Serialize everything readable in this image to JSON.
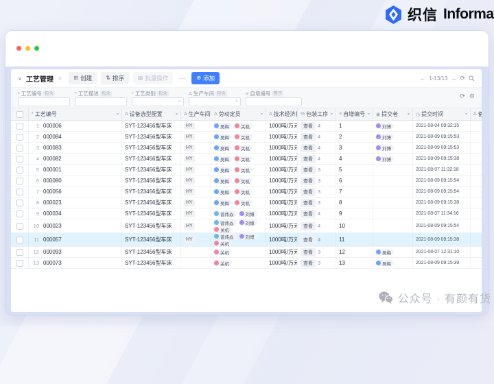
{
  "brand": {
    "name_cn": "织信",
    "name_en": "Informat",
    "accent": "#2e6bf6"
  },
  "window_controls": {
    "close": "#ff5f57",
    "minimize": "#febc2e",
    "zoom": "#28c840"
  },
  "toolbar": {
    "caret": "∨",
    "view_name": "工艺管理",
    "collapse_icon": "«",
    "buttons": [
      {
        "id": "create",
        "glyph": "⊞",
        "label": "创建",
        "enabled": true,
        "primary": false
      },
      {
        "id": "sort",
        "glyph": "⇅",
        "label": "排序",
        "enabled": true,
        "primary": false
      },
      {
        "id": "batch",
        "glyph": "▦",
        "label": "批量操作",
        "enabled": false,
        "primary": false
      },
      {
        "id": "divider",
        "type": "divider",
        "glyph": "—"
      },
      {
        "id": "add",
        "glyph": "⊕",
        "label": "添加",
        "enabled": true,
        "primary": true
      }
    ],
    "pagination": {
      "prev": "←",
      "range": "1-13/13",
      "next": "→",
      "refresh": "⟳"
    }
  },
  "filters": {
    "items": [
      {
        "id": "code",
        "icon": "*",
        "label": "工艺编号",
        "op": "包含",
        "control": "input",
        "value": ""
      },
      {
        "id": "desc",
        "icon": "*",
        "label": "工艺描述",
        "op": "包含",
        "control": "input",
        "value": ""
      },
      {
        "id": "category",
        "icon": "*",
        "label": "工艺类别",
        "op": "包含",
        "control": "select",
        "value": ""
      },
      {
        "id": "workshop",
        "icon": "A",
        "label": "生产车间",
        "op": "包含",
        "control": "select",
        "value": ""
      },
      {
        "id": "autono",
        "icon": "≡",
        "label": "自增编号",
        "op": "等于",
        "control": "input",
        "value": ""
      }
    ],
    "refresh_icon": "⟳",
    "settings_icon": "⚙"
  },
  "table": {
    "columns": [
      {
        "id": "code",
        "icon": "*",
        "label": "工艺编号"
      },
      {
        "id": "device",
        "icon": "A",
        "label": "设备选型配置"
      },
      {
        "id": "workshop",
        "icon": "A",
        "label": "生产车间"
      },
      {
        "id": "staff",
        "icon": "A",
        "label": "劳动定员"
      },
      {
        "id": "indicator",
        "icon": "A",
        "label": "技术经济指标"
      },
      {
        "id": "process",
        "icon": "%",
        "label": "包装工序"
      },
      {
        "id": "autono",
        "icon": "≡",
        "label": "自增编号"
      },
      {
        "id": "submitter",
        "icon": "◉",
        "label": "提交者"
      },
      {
        "id": "time",
        "icon": "◷",
        "label": "提交时间"
      },
      {
        "id": "note",
        "icon": "A",
        "label": "备注"
      }
    ],
    "view_button_label": "查看",
    "people_colors": {
      "吴梅": "#6fa4f8",
      "关机": "#f2849c",
      "曾炜焱": "#66b9e8",
      "刘博": "#a78bf0"
    },
    "rows": [
      {
        "index": 1,
        "code": "000006",
        "device": "SYT-123456型车床",
        "workshop": "HY",
        "staff": [
          "吴梅",
          "关机"
        ],
        "indicator": "1000吨/万元",
        "view_count": 4,
        "auto_no": 1,
        "submitter": "刘博",
        "time": "2021-08-04 09:32:15",
        "highlighted": false,
        "tall": false
      },
      {
        "index": 2,
        "code": "000084",
        "device": "SYT-123456型车床",
        "workshop": "HY",
        "staff": [
          "吴梅",
          "关机"
        ],
        "indicator": "1000吨/万元",
        "view_count": 4,
        "auto_no": 2,
        "submitter": "刘博",
        "time": "2021-08-09 09:15:53",
        "highlighted": false,
        "tall": false
      },
      {
        "index": 3,
        "code": "000083",
        "device": "SYT-123456型车床",
        "workshop": "HY",
        "staff": [
          "吴梅",
          "关机"
        ],
        "indicator": "1000吨/万元",
        "view_count": 4,
        "auto_no": 3,
        "submitter": "刘博",
        "time": "2021-08-09 09:15:53",
        "highlighted": false,
        "tall": false
      },
      {
        "index": 4,
        "code": "000082",
        "device": "SYT-123456型车床",
        "workshop": "HY",
        "staff": [
          "吴梅",
          "关机"
        ],
        "indicator": "1000吨/万元",
        "view_count": 4,
        "auto_no": 4,
        "submitter": "刘博",
        "time": "2021-08-09 09:15:38",
        "highlighted": false,
        "tall": false
      },
      {
        "index": 5,
        "code": "000001",
        "device": "SYT-123456型车床",
        "workshop": "HY",
        "staff": [
          "吴梅",
          "关机"
        ],
        "indicator": "1000吨/万元",
        "view_count": 3,
        "auto_no": 5,
        "submitter": null,
        "time": "2021-08-07 11:32:18",
        "highlighted": false,
        "tall": false
      },
      {
        "index": 6,
        "code": "000080",
        "device": "SYT-123456型车床",
        "workshop": "HY",
        "staff": [
          "吴梅",
          "关机"
        ],
        "indicator": "1000吨/万元",
        "view_count": 3,
        "auto_no": 6,
        "submitter": null,
        "time": "2021-08-09 09:15:54",
        "highlighted": false,
        "tall": false
      },
      {
        "index": 7,
        "code": "000056",
        "device": "SYT-123456型车床",
        "workshop": "HY",
        "staff": [
          "吴梅",
          "关机"
        ],
        "indicator": "1000吨/万元",
        "view_count": 3,
        "auto_no": 7,
        "submitter": null,
        "time": "2021-08-09 09:15:54",
        "highlighted": false,
        "tall": false
      },
      {
        "index": 8,
        "code": "000023",
        "device": "SYT-123456型车床",
        "workshop": "HY",
        "staff": [
          "吴梅",
          "关机"
        ],
        "indicator": "1000吨/万元",
        "view_count": 3,
        "auto_no": 8,
        "submitter": null,
        "time": "2021-08-09 09:15:38",
        "highlighted": false,
        "tall": false
      },
      {
        "index": 9,
        "code": "000034",
        "device": "SYT-123456型车床",
        "workshop": "HY",
        "staff": [
          "曾炜焱",
          "刘博"
        ],
        "indicator": "1000吨/万元",
        "view_count": 4,
        "auto_no": 9,
        "submitter": null,
        "time": "2021-08-07 11:34:16",
        "highlighted": false,
        "tall": false
      },
      {
        "index": 10,
        "code": "000023",
        "device": "SYT-123456型车床",
        "workshop": "HY",
        "staff": [
          "曾炜焱",
          "刘博",
          "关机"
        ],
        "indicator": "1000吨/万元",
        "view_count": 4,
        "auto_no": 10,
        "submitter": null,
        "time": "2021-08-09 09:15:54",
        "highlighted": false,
        "tall": true
      },
      {
        "index": 11,
        "code": "000057",
        "device": "SYT-123456型车床",
        "workshop": "HY",
        "staff": [
          "曾炜焱",
          "刘博",
          "关机"
        ],
        "indicator": "1000吨/万元",
        "view_count": 4,
        "auto_no": 11,
        "submitter": null,
        "time": "2021-08-09 09:15:38",
        "highlighted": true,
        "tall": true
      },
      {
        "index": 12,
        "code": "000093",
        "device": "SYT-123456型车床",
        "workshop": "",
        "staff": [
          "关机"
        ],
        "indicator": "1000吨/万元",
        "view_count": 3,
        "auto_no": 12,
        "submitter": "吴梅",
        "time": "2021-08-07 12:31:10",
        "highlighted": false,
        "tall": false
      },
      {
        "index": 13,
        "code": "000073",
        "device": "SYT-123456型车床",
        "workshop": "",
        "staff": [
          "关机"
        ],
        "indicator": "1000吨/万元",
        "view_count": 3,
        "auto_no": 13,
        "submitter": "吴梅",
        "time": "2021-08-09 09:15:39",
        "highlighted": false,
        "tall": false
      }
    ]
  },
  "watermark": {
    "text": "公众号 · 有颜有货"
  }
}
